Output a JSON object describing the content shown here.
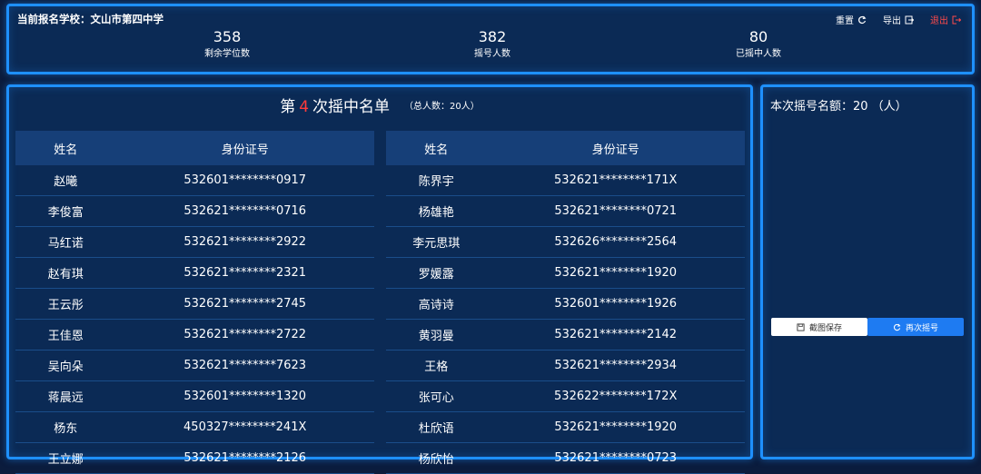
{
  "header": {
    "school_label": "当前报名学校：文山市第四中学",
    "actions": {
      "reset": "重置",
      "export": "导出",
      "exit": "退出"
    },
    "stats": [
      {
        "value": "358",
        "label": "剩余学位数"
      },
      {
        "value": "382",
        "label": "摇号人数"
      },
      {
        "value": "80",
        "label": "已摇中人数"
      }
    ]
  },
  "list": {
    "title_prefix": "第",
    "round": "4",
    "title_suffix": "次摇中名单",
    "total": "（总人数：20人）",
    "columns": {
      "name": "姓名",
      "id": "身份证号"
    },
    "left": [
      {
        "name": "赵曦",
        "id": "532601********0917"
      },
      {
        "name": "李俊富",
        "id": "532621********0716"
      },
      {
        "name": "马红诺",
        "id": "532621********2922"
      },
      {
        "name": "赵有琪",
        "id": "532621********2321"
      },
      {
        "name": "王云彤",
        "id": "532621********2745"
      },
      {
        "name": "王佳恩",
        "id": "532621********2722"
      },
      {
        "name": "吴向朵",
        "id": "532621********7623"
      },
      {
        "name": "蒋晨远",
        "id": "532601********1320"
      },
      {
        "name": "杨东",
        "id": "450327********241X"
      },
      {
        "name": "王立娜",
        "id": "532621********2126"
      }
    ],
    "right": [
      {
        "name": "陈界宇",
        "id": "532621********171X"
      },
      {
        "name": "杨雄艳",
        "id": "532621********0721"
      },
      {
        "name": "李元思琪",
        "id": "532626********2564"
      },
      {
        "name": "罗媛露",
        "id": "532621********1920"
      },
      {
        "name": "高诗诗",
        "id": "532601********1926"
      },
      {
        "name": "黄羽曼",
        "id": "532621********2142"
      },
      {
        "name": "王格",
        "id": "532621********2934"
      },
      {
        "name": "张可心",
        "id": "532622********172X"
      },
      {
        "name": "杜欣语",
        "id": "532621********1920"
      },
      {
        "name": "杨欣怡",
        "id": "532621********0723"
      }
    ]
  },
  "side": {
    "quota": "本次摇号名额：20 （人）",
    "screenshot_label": "截图保存",
    "redraw_label": "再次摇号"
  },
  "colors": {
    "accent": "#1e90ff",
    "highlight": "#ff3b3b",
    "button": "#1e7bf2"
  }
}
